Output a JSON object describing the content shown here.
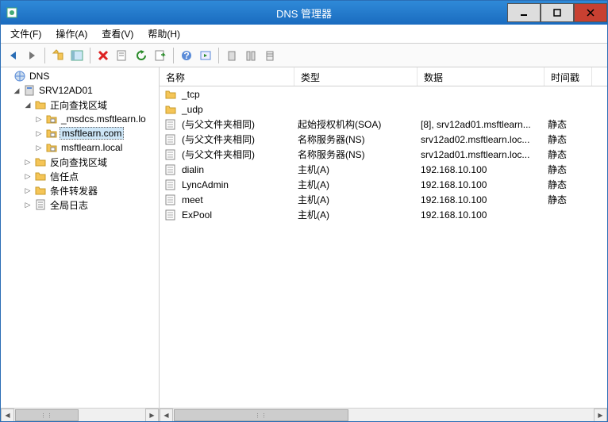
{
  "window": {
    "title": "DNS 管理器"
  },
  "menu": {
    "file": "文件(F)",
    "action": "操作(A)",
    "view": "查看(V)",
    "help": "帮助(H)"
  },
  "tree": {
    "root": "DNS",
    "server": "SRV12AD01",
    "fwd_zone": "正向查找区域",
    "zone_msdcs": "_msdcs.msftlearn.lo",
    "zone_msftlearn_com": "msftlearn.com",
    "zone_msftlearn_local": "msftlearn.local",
    "rev_zone": "反向查找区域",
    "trust_points": "信任点",
    "cond_fwd": "条件转发器",
    "global_log": "全局日志"
  },
  "columns": {
    "name": "名称",
    "type": "类型",
    "data": "数据",
    "ts": "时间戳"
  },
  "rows": [
    {
      "icon": "folder",
      "name": "_tcp",
      "type": "",
      "data": "",
      "ts": ""
    },
    {
      "icon": "folder",
      "name": "_udp",
      "type": "",
      "data": "",
      "ts": ""
    },
    {
      "icon": "record",
      "name": "(与父文件夹相同)",
      "type": "起始授权机构(SOA)",
      "data": "[8], srv12ad01.msftlearn...",
      "ts": "静态"
    },
    {
      "icon": "record",
      "name": "(与父文件夹相同)",
      "type": "名称服务器(NS)",
      "data": "srv12ad02.msftlearn.loc...",
      "ts": "静态"
    },
    {
      "icon": "record",
      "name": "(与父文件夹相同)",
      "type": "名称服务器(NS)",
      "data": "srv12ad01.msftlearn.loc...",
      "ts": "静态"
    },
    {
      "icon": "record",
      "name": "dialin",
      "type": "主机(A)",
      "data": "192.168.10.100",
      "ts": "静态"
    },
    {
      "icon": "record",
      "name": "LyncAdmin",
      "type": "主机(A)",
      "data": "192.168.10.100",
      "ts": "静态"
    },
    {
      "icon": "record",
      "name": "meet",
      "type": "主机(A)",
      "data": "192.168.10.100",
      "ts": "静态"
    },
    {
      "icon": "record",
      "name": "ExPool",
      "type": "主机(A)",
      "data": "192.168.10.100",
      "ts": ""
    }
  ]
}
